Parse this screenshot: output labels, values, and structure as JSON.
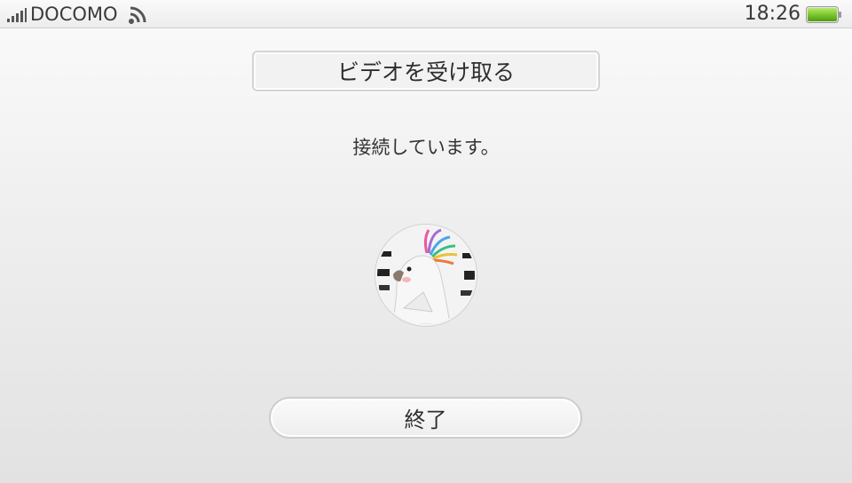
{
  "status_bar": {
    "carrier": "DOCOMO",
    "time": "18:26",
    "signal_icon": "signal-bars-icon",
    "network_icon": "wifi-icon",
    "battery_icon": "battery-full-icon",
    "battery_level": 1.0,
    "battery_color": "#7cc72e"
  },
  "main": {
    "title_button": "ビデオを受け取る",
    "status_message": "接続しています。",
    "avatar_icon": "bird-avatar",
    "end_button": "終了"
  }
}
